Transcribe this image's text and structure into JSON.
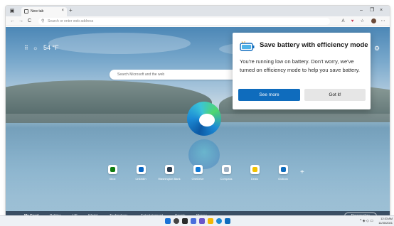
{
  "browser": {
    "tab_title": "New tab",
    "tab_close": "×",
    "new_tab": "+",
    "window_controls": {
      "minimize": "–",
      "restore": "❐",
      "close": "×"
    },
    "address_placeholder": "Search or enter web address",
    "nav": {
      "back": "←",
      "forward": "→",
      "refresh": "C"
    }
  },
  "newtab": {
    "apps_icon": "⠿",
    "weather_icon": "☼",
    "temperature": "54 °F",
    "settings_icon": "⚙",
    "search_placeholder": "Search Microsoft and the web",
    "quick_links": [
      {
        "label": "Xbox",
        "color": "#107c10"
      },
      {
        "label": "LinkedIn",
        "color": "#0a66c2"
      },
      {
        "label": "Washington Bank",
        "color": "#2d3e50"
      },
      {
        "label": "OneDrive",
        "color": "#0f78d4"
      },
      {
        "label": "Compass",
        "color": "#9fb0c2"
      },
      {
        "label": "Deals",
        "color": "#f2c200"
      },
      {
        "label": "Outlook",
        "color": "#0f6cbd"
      }
    ],
    "add_link": "+",
    "feed": {
      "items": [
        "My Feed",
        "Politics",
        "US",
        "World",
        "Technology",
        "Entertainment",
        "Sports",
        "Money"
      ],
      "personalize": "Personalize"
    }
  },
  "popup": {
    "title": "Save battery with efficiency mode",
    "body": "You're running low on battery. Don't worry, we've turned on efficiency mode to help you save battery.",
    "primary_button": "See more",
    "secondary_button": "Got it!",
    "accent_color": "#0f6cbd"
  },
  "taskbar": {
    "tray": "^ ◈ ◇ ▭",
    "time": "12:33 AM",
    "date": "11/30/2021"
  }
}
